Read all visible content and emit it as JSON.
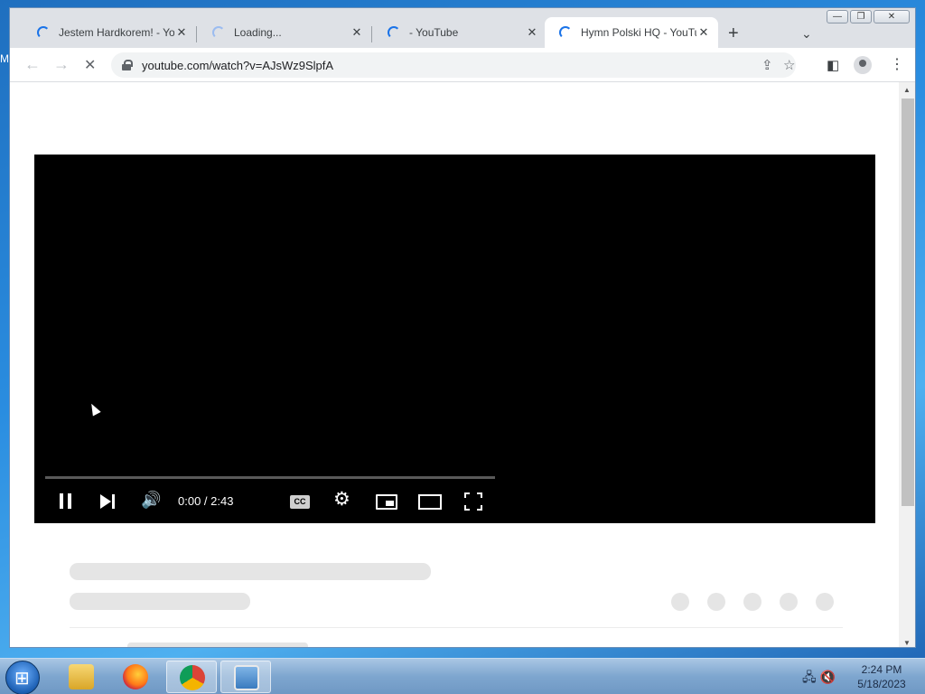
{
  "desktop": {
    "edge_letter": "M"
  },
  "window_controls": {
    "minimize": "—",
    "restore": "❐",
    "close": "✕"
  },
  "tabs": [
    {
      "title": "Jestem Hardkorem! - Yo",
      "loading": true,
      "active": false
    },
    {
      "title": "Loading...",
      "loading": true,
      "active": false
    },
    {
      "title": "- YouTube",
      "loading": true,
      "active": false
    },
    {
      "title": "Hymn Polski HQ - YouTu",
      "loading": true,
      "active": true
    }
  ],
  "tab_close": "✕",
  "new_tab": "+",
  "tab_search": "⌄",
  "toolbar": {
    "back": "←",
    "forward": "→",
    "stop": "✕",
    "url": "youtube.com/watch?v=AJsWz9SlpfA",
    "share": "⇪",
    "bookmark": "☆",
    "side_panel": "◧",
    "menu": "⋮"
  },
  "player": {
    "time": "0:00 / 2:43",
    "cc_label": "CC",
    "volume": "🔊",
    "settings": "⚙"
  },
  "scroll": {
    "up": "▲",
    "down": "▼"
  },
  "taskbar": {
    "apps": [
      "explorer-icon",
      "firefox-icon",
      "chrome-icon",
      "image-viewer-icon"
    ],
    "tray_icons": "🖧 🔇",
    "time": "2:24 PM",
    "date": "5/18/2023"
  }
}
